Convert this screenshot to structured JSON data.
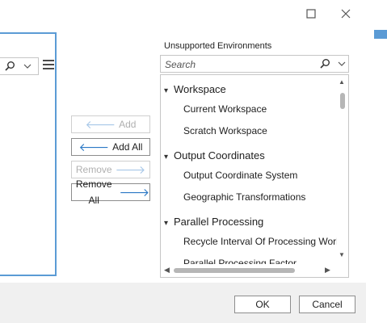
{
  "left_panel": {
    "icons": [
      "search-icon",
      "chevron-down-icon",
      "hamburger-menu-icon"
    ]
  },
  "middle_buttons": {
    "add": {
      "label": "Add",
      "enabled": false,
      "icon": "arrow-left-icon"
    },
    "add_all": {
      "label": "Add All",
      "enabled": true,
      "icon": "arrow-left-icon"
    },
    "remove": {
      "label": "Remove",
      "enabled": false,
      "icon": "arrow-right-icon"
    },
    "remove_all": {
      "label": "Remove All",
      "enabled": true,
      "icon": "arrow-right-icon"
    }
  },
  "unsupported": {
    "title": "Unsupported Environments",
    "search_placeholder": "Search",
    "groups": [
      {
        "label": "Workspace",
        "items": [
          "Current Workspace",
          "Scratch Workspace"
        ]
      },
      {
        "label": "Output Coordinates",
        "items": [
          "Output Coordinate System",
          "Geographic Transformations"
        ]
      },
      {
        "label": "Parallel Processing",
        "items": [
          "Recycle Interval Of Processing Workers",
          "Parallel Processing Factor"
        ]
      }
    ]
  },
  "footer": {
    "ok_label": "OK",
    "cancel_label": "Cancel"
  },
  "colors": {
    "accent": "#5b9bd5",
    "arrow": "#2b78c5",
    "border": "#c6c6c6",
    "dialog_bg": "#f0f0f0"
  }
}
